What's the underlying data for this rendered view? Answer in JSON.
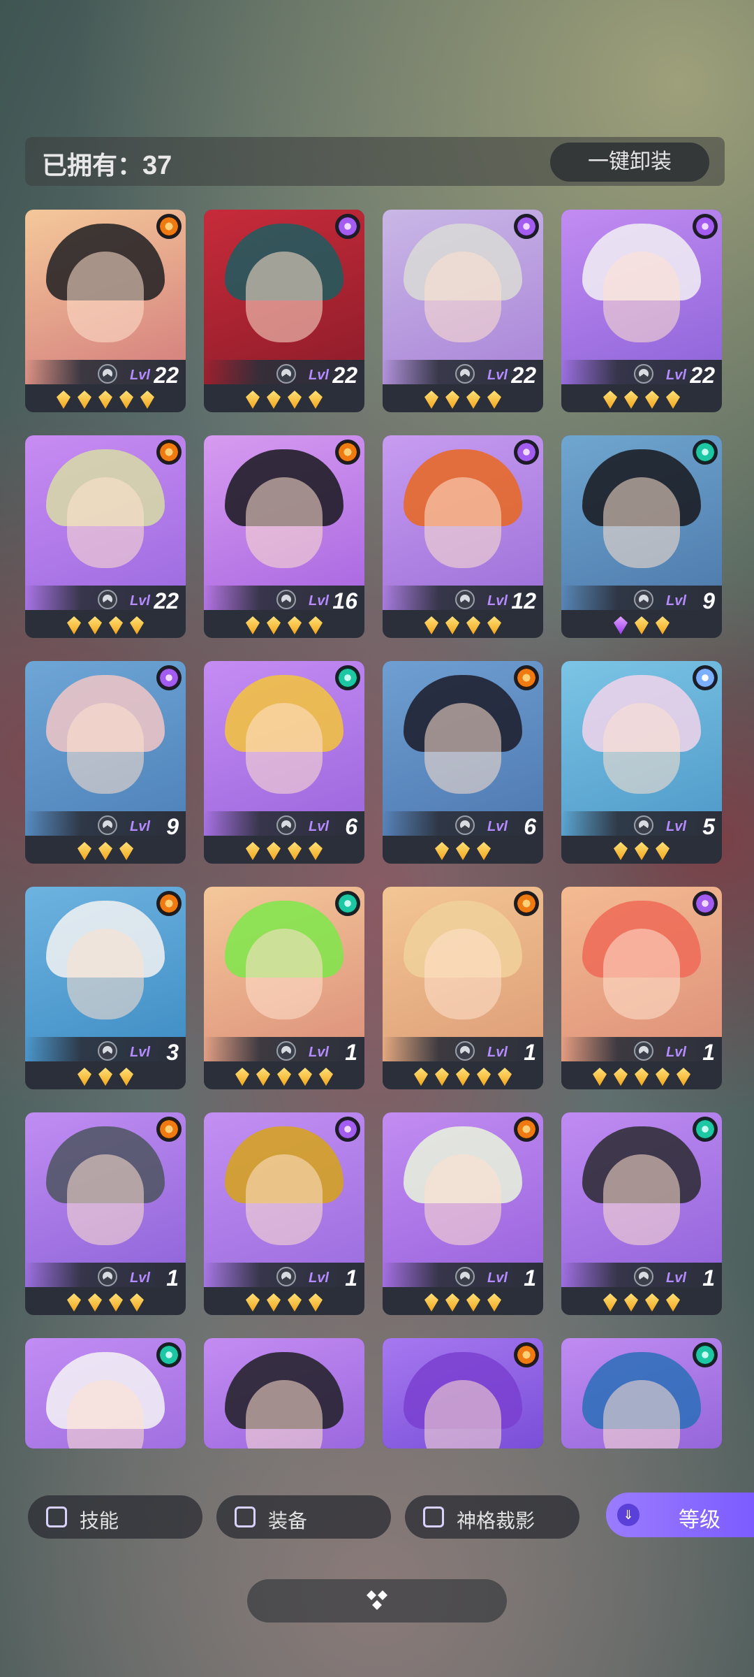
{
  "header": {
    "owned_label": "已拥有：",
    "owned_count": "37",
    "unequip_all_label": "一键卸装"
  },
  "level_prefix": "Lvl",
  "heroes": [
    {
      "level": "22",
      "stars": 5,
      "purple": 0,
      "element": "sun-icon",
      "bg": [
        "#f4c89a",
        "#d37c7c"
      ],
      "hair": "#1e1e22"
    },
    {
      "level": "22",
      "stars": 4,
      "purple": 0,
      "element": "arcane-icon",
      "bg": [
        "#c72b3a",
        "#8d1c2a"
      ],
      "hair": "#1c5d60"
    },
    {
      "level": "22",
      "stars": 4,
      "purple": 0,
      "element": "arcane-icon",
      "bg": [
        "#c9b7e6",
        "#a983d8"
      ],
      "hair": "#d9dad6"
    },
    {
      "level": "22",
      "stars": 4,
      "purple": 0,
      "element": "arcane-icon",
      "bg": [
        "#c28cf2",
        "#8c63d8"
      ],
      "hair": "#f2f0f4"
    },
    {
      "level": "22",
      "stars": 4,
      "purple": 0,
      "element": "sun-icon",
      "bg": [
        "#c88cf2",
        "#9b6ae0"
      ],
      "hair": "#d7dca4"
    },
    {
      "level": "16",
      "stars": 4,
      "purple": 0,
      "element": "sun-icon",
      "bg": [
        "#d79bf0",
        "#a765e0"
      ],
      "hair": "#17171d"
    },
    {
      "level": "12",
      "stars": 4,
      "purple": 0,
      "element": "arcane-icon",
      "bg": [
        "#c79cf0",
        "#9c6fd8"
      ],
      "hair": "#e9671f"
    },
    {
      "level": "9",
      "stars": 3,
      "purple": 1,
      "element": "wind-icon",
      "bg": [
        "#6fa6cf",
        "#4d79ab"
      ],
      "hair": "#18181d"
    },
    {
      "level": "9",
      "stars": 3,
      "purple": 0,
      "element": "arcane-icon",
      "bg": [
        "#6ea6d6",
        "#4d80b8"
      ],
      "hair": "#f1c6c5"
    },
    {
      "level": "6",
      "stars": 4,
      "purple": 0,
      "element": "wind-icon",
      "bg": [
        "#c58cf3",
        "#9b66dd"
      ],
      "hair": "#f3c43b"
    },
    {
      "level": "6",
      "stars": 3,
      "purple": 0,
      "element": "sun-icon",
      "bg": [
        "#6f9fd2",
        "#4d78b0"
      ],
      "hair": "#1c1b29"
    },
    {
      "level": "5",
      "stars": 3,
      "purple": 0,
      "element": "void-icon",
      "bg": [
        "#7cc5e6",
        "#4d98c8"
      ],
      "hair": "#f1d4ea"
    },
    {
      "level": "3",
      "stars": 3,
      "purple": 0,
      "element": "sun-icon",
      "bg": [
        "#6eb3e0",
        "#3d8cc4"
      ],
      "hair": "#f2f2f2"
    },
    {
      "level": "1",
      "stars": 5,
      "purple": 0,
      "element": "wind-icon",
      "bg": [
        "#f4c89a",
        "#dc8f7a"
      ],
      "hair": "#7ee84a"
    },
    {
      "level": "1",
      "stars": 5,
      "purple": 0,
      "element": "sun-icon",
      "bg": [
        "#f3c694",
        "#dd9c77"
      ],
      "hair": "#f0d19b"
    },
    {
      "level": "1",
      "stars": 5,
      "purple": 0,
      "element": "arcane-icon",
      "bg": [
        "#f4bb92",
        "#dd8f78"
      ],
      "hair": "#ee6a57"
    },
    {
      "level": "1",
      "stars": 4,
      "purple": 0,
      "element": "sun-icon",
      "bg": [
        "#c08df2",
        "#8d63d8"
      ],
      "hair": "#4d5560"
    },
    {
      "level": "1",
      "stars": 4,
      "purple": 0,
      "element": "arcane-icon",
      "bg": [
        "#c38ff2",
        "#9a6cde"
      ],
      "hair": "#d6a317"
    },
    {
      "level": "1",
      "stars": 4,
      "purple": 0,
      "element": "sun-icon",
      "bg": [
        "#c28cf2",
        "#9863dc"
      ],
      "hair": "#e9f4dc"
    },
    {
      "level": "1",
      "stars": 4,
      "purple": 0,
      "element": "wind-icon",
      "bg": [
        "#c08cf2",
        "#9163da"
      ],
      "hair": "#2a2a30"
    },
    {
      "level": "",
      "stars": 0,
      "purple": 0,
      "element": "wind-icon",
      "bg": [
        "#c18cf3",
        "#a170e0"
      ],
      "hair": "#f4f4f6"
    },
    {
      "level": "",
      "stars": 0,
      "purple": 0,
      "element": "",
      "bg": [
        "#c48cf2",
        "#9b68de"
      ],
      "hair": "#1e1e24"
    },
    {
      "level": "",
      "stars": 0,
      "purple": 0,
      "element": "sun-icon",
      "bg": [
        "#a678f0",
        "#7a4fd8"
      ],
      "hair": "#7a3fd0"
    },
    {
      "level": "",
      "stars": 0,
      "purple": 0,
      "element": "wind-icon",
      "bg": [
        "#c08cf2",
        "#9566da"
      ],
      "hair": "#2a6fb8"
    }
  ],
  "filters": {
    "skill_label": "技能",
    "equipment_label": "装备",
    "divine_cut_label": "神格裁影",
    "sort_label": "等级"
  }
}
